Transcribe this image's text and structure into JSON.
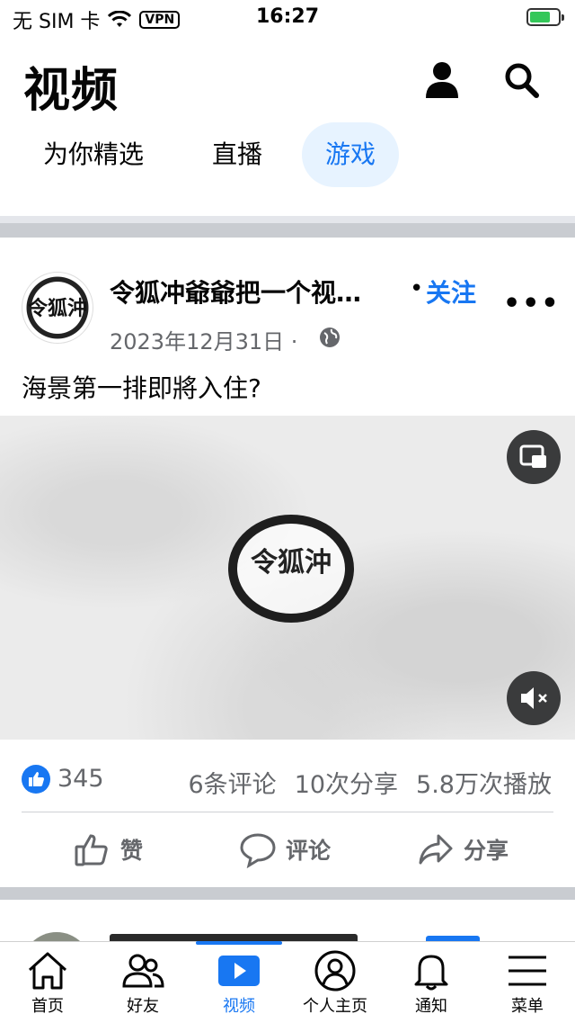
{
  "status_bar": {
    "carrier": "无 SIM 卡",
    "vpn": "VPN",
    "time": "16:27"
  },
  "header": {
    "title": "视频",
    "icons": [
      "person-icon",
      "search-icon"
    ]
  },
  "tabs": [
    {
      "label": "为你精选",
      "active": false
    },
    {
      "label": "直播",
      "active": false
    },
    {
      "label": "游戏",
      "active": true
    }
  ],
  "post": {
    "avatar_text": "令狐沖",
    "author": "令狐冲爺爺把一个视…",
    "follow_dot": "•",
    "follow": "关注",
    "date": "2023年12月31日 ·",
    "caption": "海景第一排即將入住?",
    "video_logo_text": "令狐沖",
    "likes": "345",
    "comments": "6条评论",
    "shares": "10次分享",
    "views": "5.8万次播放",
    "actions": {
      "like": "赞",
      "comment": "评论",
      "share": "分享"
    }
  },
  "tab_bar": [
    {
      "label": "首页",
      "icon": "home-icon",
      "active": false
    },
    {
      "label": "好友",
      "icon": "friends-icon",
      "active": false
    },
    {
      "label": "视频",
      "icon": "video-icon",
      "active": true
    },
    {
      "label": "个人主页",
      "icon": "profile-icon",
      "active": false
    },
    {
      "label": "通知",
      "icon": "bell-icon",
      "active": false
    },
    {
      "label": "菜单",
      "icon": "menu-icon",
      "active": false
    }
  ],
  "colors": {
    "accent": "#1877f2",
    "muted": "#65676b",
    "divider": "#c9ccd1"
  }
}
